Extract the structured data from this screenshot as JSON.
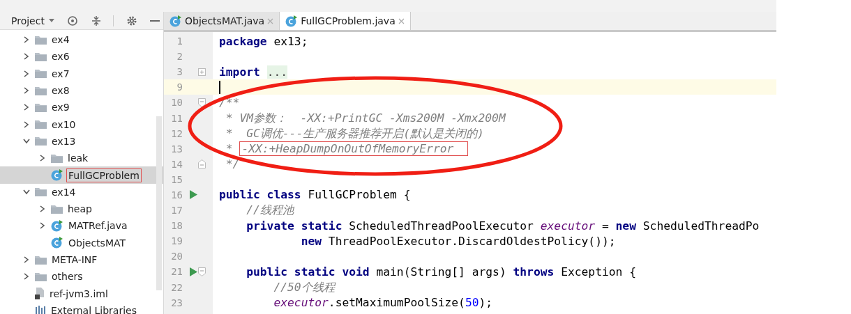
{
  "toolbar": {
    "view_label": "Project"
  },
  "tree": [
    {
      "label": "ex4",
      "kind": "folder",
      "expanded": false,
      "selected": false,
      "boxed": false
    },
    {
      "label": "ex6",
      "kind": "folder",
      "expanded": false,
      "selected": false,
      "boxed": false
    },
    {
      "label": "ex7",
      "kind": "folder",
      "expanded": false,
      "selected": false,
      "boxed": false
    },
    {
      "label": "ex8",
      "kind": "folder",
      "expanded": false,
      "selected": false,
      "boxed": false
    },
    {
      "label": "ex9",
      "kind": "folder",
      "expanded": false,
      "selected": false,
      "boxed": false
    },
    {
      "label": "ex10",
      "kind": "folder",
      "expanded": false,
      "selected": false,
      "boxed": false
    },
    {
      "label": "ex13",
      "kind": "folder",
      "expanded": true,
      "selected": false,
      "boxed": false,
      "children": [
        {
          "label": "leak",
          "kind": "folder",
          "expanded": false,
          "selected": false,
          "boxed": false
        },
        {
          "label": "FullGCProblem",
          "kind": "class",
          "selected": true,
          "boxed": true
        }
      ]
    },
    {
      "label": "ex14",
      "kind": "folder",
      "expanded": true,
      "selected": false,
      "boxed": false,
      "children": [
        {
          "label": "heap",
          "kind": "folder",
          "expanded": false,
          "selected": false,
          "boxed": false
        },
        {
          "label": "MATRef.java",
          "kind": "class",
          "expanded": false,
          "selected": false,
          "boxed": false
        },
        {
          "label": "ObjectsMAT",
          "kind": "class",
          "selected": false,
          "boxed": false
        }
      ]
    },
    {
      "label": "META-INF",
      "kind": "folder",
      "expanded": false,
      "selected": false,
      "boxed": false
    },
    {
      "label": "others",
      "kind": "folder",
      "expanded": false,
      "selected": false,
      "boxed": false
    },
    {
      "label": "ref-jvm3.iml",
      "kind": "file",
      "selected": false,
      "boxed": false
    },
    {
      "label": "External Libraries",
      "kind": "library",
      "selected": false,
      "boxed": false
    }
  ],
  "tabs": [
    {
      "label": "ObjectsMAT.java",
      "selected": false
    },
    {
      "label": "FullGCProblem.java",
      "selected": true
    }
  ],
  "editor": {
    "lines": [
      {
        "number": "1",
        "tokens": [
          {
            "kind": "kw",
            "text": "package"
          },
          {
            "kind": "plain",
            "text": " ex13;"
          }
        ]
      },
      {
        "number": "2"
      },
      {
        "number": "3",
        "folded": true,
        "tokens": [
          {
            "kind": "kw",
            "text": "import "
          },
          {
            "kind": "folded",
            "text": "..."
          }
        ]
      },
      {
        "number": "9",
        "current": true
      },
      {
        "number": "10",
        "fold_start": true,
        "tokens": [
          {
            "kind": "comment",
            "text": "/**"
          }
        ]
      },
      {
        "number": "11",
        "tokens": [
          {
            "kind": "comment",
            "text": " * VM参数：  -XX:+PrintGC -Xms200M -Xmx200M"
          }
        ]
      },
      {
        "number": "12",
        "tokens": [
          {
            "kind": "comment",
            "text": " *  GC调优---生产服务器推荐开启(默认是关闭的)"
          }
        ]
      },
      {
        "number": "13",
        "tokens": [
          {
            "kind": "comment",
            "text": " * "
          },
          {
            "kind": "comment",
            "text": "-XX:+HeapDumpOnOutOfMemoryError",
            "boxed": true
          }
        ]
      },
      {
        "number": "14",
        "fold_end": true,
        "tokens": [
          {
            "kind": "comment",
            "text": " */"
          }
        ]
      },
      {
        "number": "15"
      },
      {
        "number": "16",
        "run": true,
        "tokens": [
          {
            "kind": "kw",
            "text": "public class"
          },
          {
            "kind": "plain",
            "text": " FullGCProblem {"
          }
        ]
      },
      {
        "number": "17",
        "tokens": [
          {
            "kind": "comment",
            "text": "    //线程池"
          }
        ]
      },
      {
        "number": "18",
        "tokens": [
          {
            "kind": "kw",
            "text": "    private static"
          },
          {
            "kind": "plain",
            "text": " ScheduledThreadPoolExecutor "
          },
          {
            "kind": "field",
            "text": "executor"
          },
          {
            "kind": "plain",
            "text": " = "
          },
          {
            "kind": "kw",
            "text": "new"
          },
          {
            "kind": "plain",
            "text": " ScheduledThreadPo"
          }
        ]
      },
      {
        "number": "19",
        "tokens": [
          {
            "kind": "kw",
            "text": "            new"
          },
          {
            "kind": "plain",
            "text": " ThreadPoolExecutor.DiscardOldestPolicy());"
          }
        ]
      },
      {
        "number": "20"
      },
      {
        "number": "21",
        "run": true,
        "fold_start": true,
        "tokens": [
          {
            "kind": "kw",
            "text": "    public static void"
          },
          {
            "kind": "plain",
            "text": " main(String[] args) "
          },
          {
            "kind": "kw",
            "text": "throws"
          },
          {
            "kind": "plain",
            "text": " Exception {"
          }
        ]
      },
      {
        "number": "22",
        "tokens": [
          {
            "kind": "comment",
            "text": "        //50个线程"
          }
        ]
      },
      {
        "number": "23",
        "tokens": [
          {
            "kind": "field",
            "text": "        executor"
          },
          {
            "kind": "plain",
            "text": ".setMaximumPoolSize("
          },
          {
            "kind": "num",
            "text": "50"
          },
          {
            "kind": "plain",
            "text": ");"
          }
        ]
      }
    ]
  }
}
